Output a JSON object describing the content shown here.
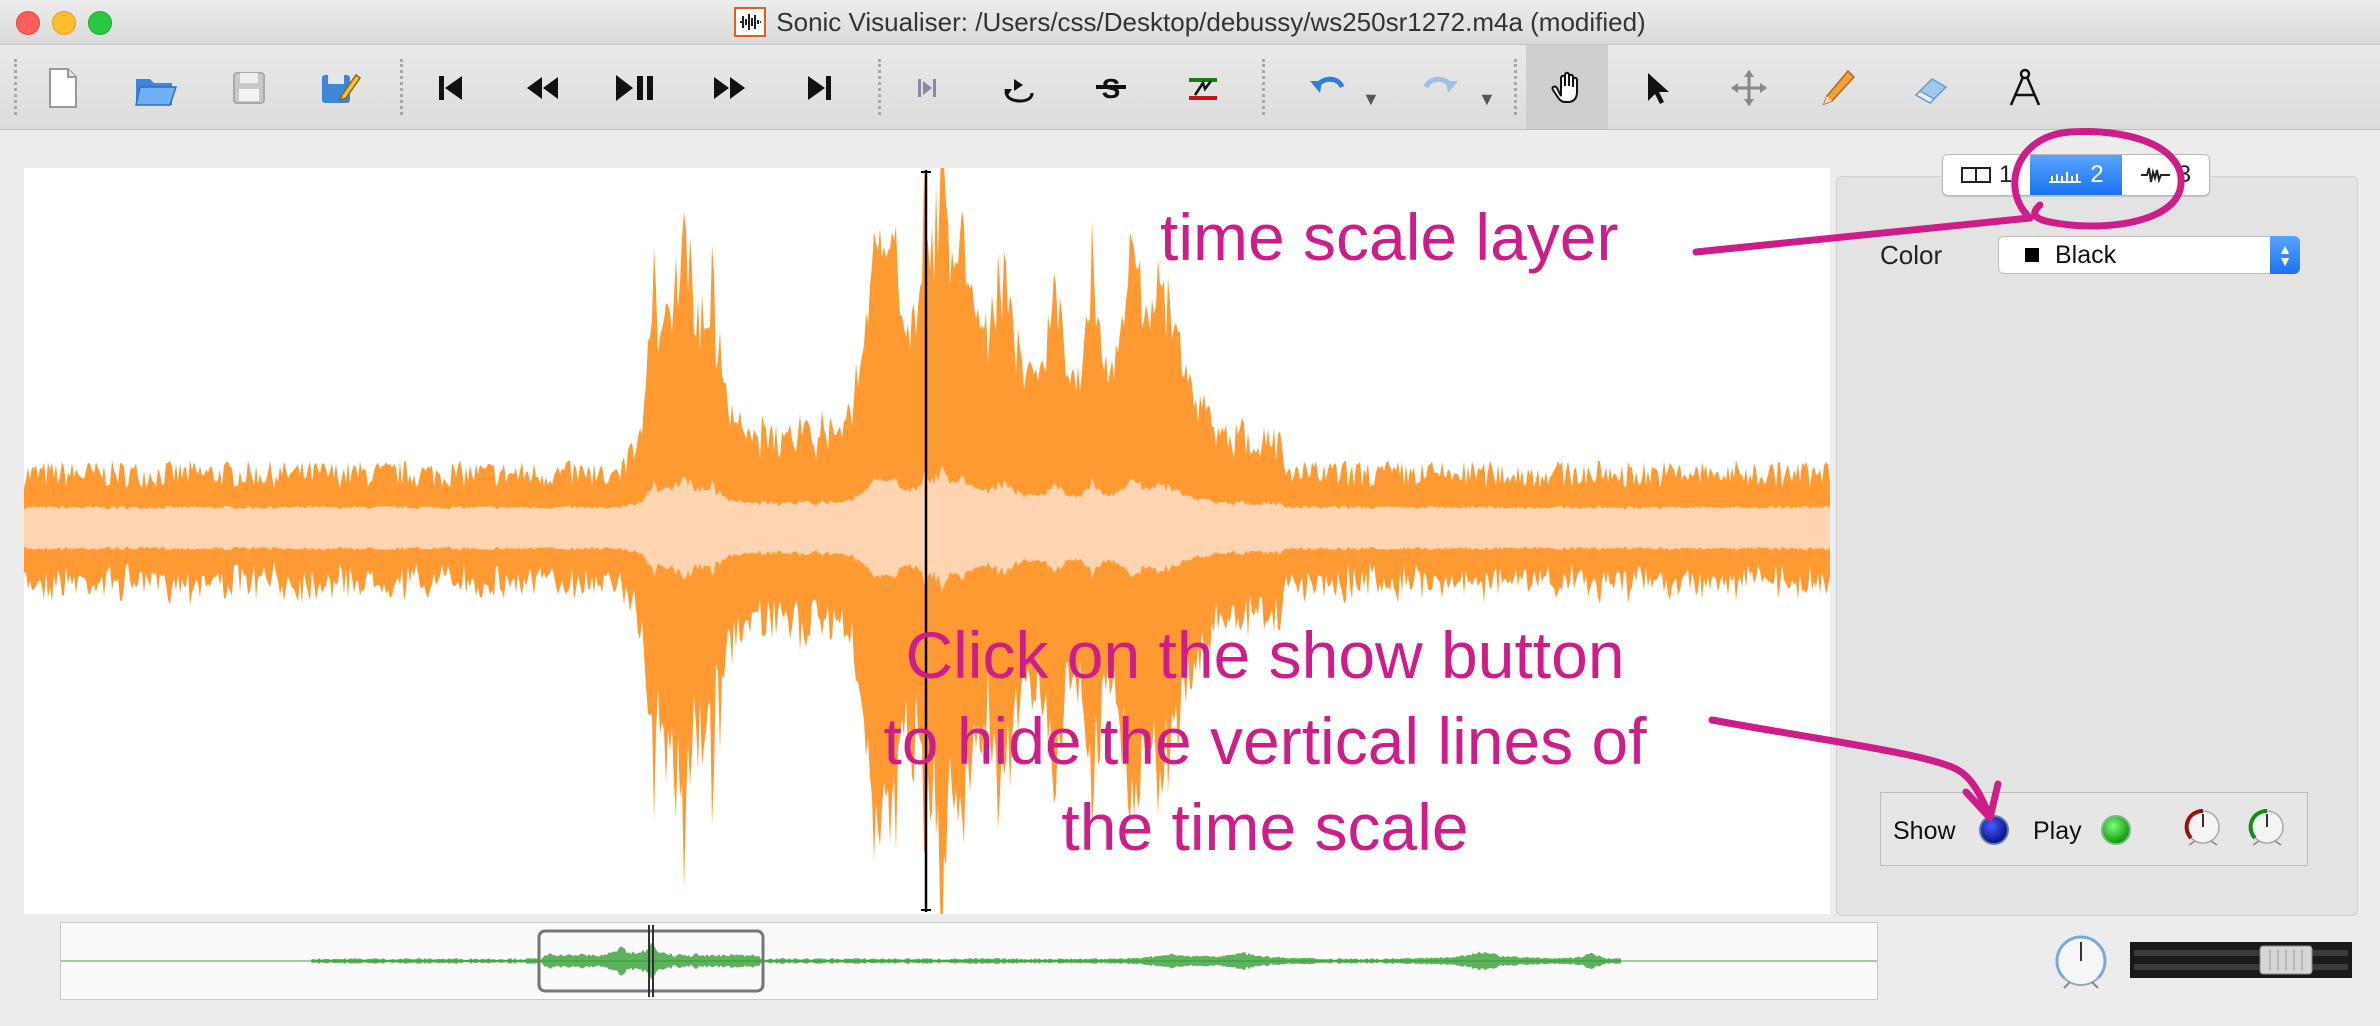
{
  "window": {
    "title": "Sonic Visualiser: /Users/css/Desktop/debussy/ws250sr1272.m4a (modified)"
  },
  "toolbar": {
    "buttons": [
      {
        "name": "new-file-icon"
      },
      {
        "name": "open-file-icon"
      },
      {
        "name": "save-file-icon"
      },
      {
        "name": "save-session-icon"
      },
      {
        "name": "rewind-start-icon"
      },
      {
        "name": "rewind-icon"
      },
      {
        "name": "play-pause-icon"
      },
      {
        "name": "fast-forward-icon"
      },
      {
        "name": "fast-forward-end-icon"
      },
      {
        "name": "constrain-playback-icon"
      },
      {
        "name": "loop-icon"
      },
      {
        "name": "solo-icon"
      },
      {
        "name": "align-icon"
      },
      {
        "name": "undo-icon"
      },
      {
        "name": "redo-icon"
      },
      {
        "name": "navigate-tool-icon"
      },
      {
        "name": "select-tool-icon"
      },
      {
        "name": "move-tool-icon"
      },
      {
        "name": "draw-tool-icon"
      },
      {
        "name": "erase-tool-icon"
      },
      {
        "name": "measure-tool-icon"
      }
    ]
  },
  "annotations": {
    "time_scale": "time scale layer",
    "instruction_lines": [
      "Click on the show button",
      "to hide the vertical lines of",
      "the time scale"
    ],
    "color": "#cc1d88"
  },
  "layer_tabs": [
    {
      "label": "1",
      "icon": "pane-icon"
    },
    {
      "label": "2",
      "icon": "time-ruler-icon",
      "selected": true
    },
    {
      "label": "3",
      "icon": "waveform-icon"
    }
  ],
  "properties": {
    "color_label": "Color",
    "color_value": "Black"
  },
  "layer_controls": {
    "show_label": "Show",
    "play_label": "Play",
    "show_on": true,
    "play_on": true
  },
  "waveform": {
    "outer_color": "#ff9a33",
    "inner_color": "#ffd4b0",
    "overview_color": "#2a9a2a"
  }
}
